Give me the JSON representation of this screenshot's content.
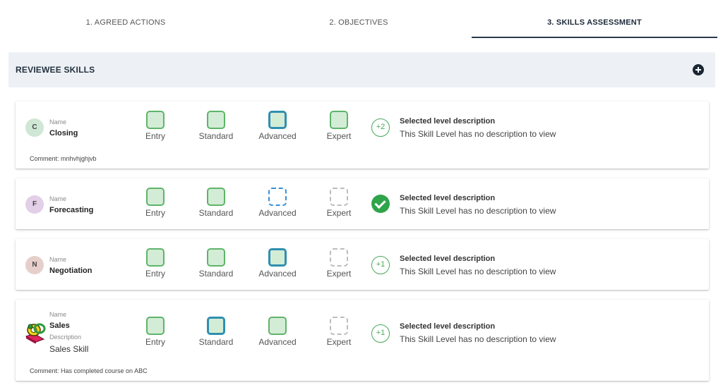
{
  "tabs": [
    {
      "label": "1. AGREED ACTIONS"
    },
    {
      "label": "2. OBJECTIVES"
    },
    {
      "label": "3. SKILLS ASSESSMENT"
    }
  ],
  "section": {
    "title": "REVIEWEE SKILLS"
  },
  "levels": [
    "Entry",
    "Standard",
    "Advanced",
    "Expert"
  ],
  "selected_level_title": "Selected level description",
  "no_description_text": "This Skill Level has no description to view",
  "name_label": "Name",
  "description_label": "Description",
  "skills": [
    {
      "initial": "C",
      "name": "Closing",
      "badge": "+2",
      "comment": "Comment: mnhvhjghjvb",
      "avatar_color": "#cfe7d4"
    },
    {
      "initial": "F",
      "name": "Forecasting",
      "badge_icon": "check-icon",
      "avatar_color": "#e3cfe7"
    },
    {
      "initial": "N",
      "name": "Negotiation",
      "badge": "+1",
      "avatar_color": "#e6cfca"
    },
    {
      "name": "Sales",
      "description": "Sales Skill",
      "badge": "+1",
      "comment": "Comment: Has completed course on ABC",
      "avatar_icon": "sales-logo-icon"
    }
  ],
  "colors": {
    "green": "#5fb46a",
    "selected_border": "#2f8fb0",
    "header_bg": "#edf1f5"
  }
}
